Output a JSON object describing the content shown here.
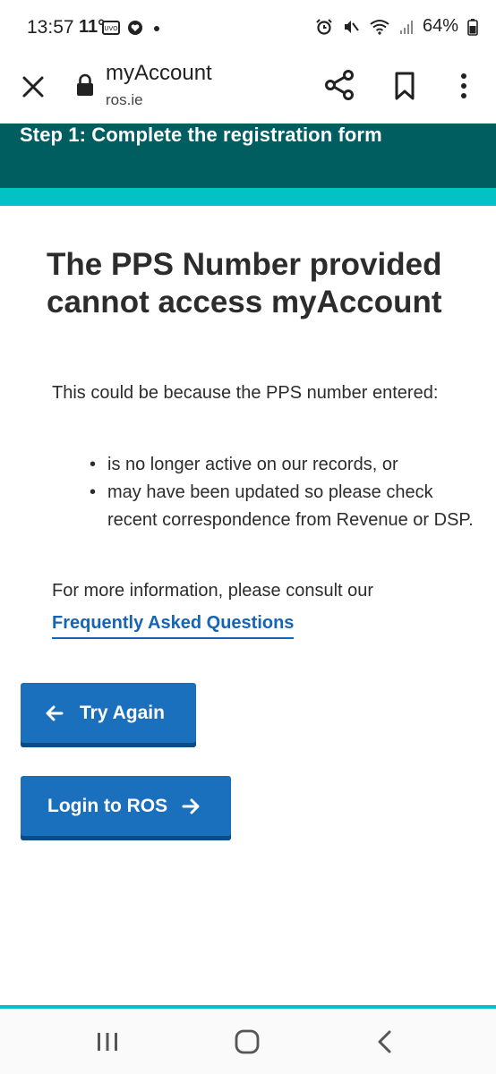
{
  "status_bar": {
    "time": "13:57",
    "temperature": "11°",
    "battery": "64%"
  },
  "browser": {
    "title": "myAccount",
    "domain": "ros.ie"
  },
  "banner": {
    "step_text": "Step 1: Complete the registration form",
    "color": "#005e60",
    "accent_color": "#03c1c5"
  },
  "content": {
    "heading": "The PPS Number provided cannot access myAccount",
    "intro": "This could be because the PPS number entered:",
    "reasons": [
      "is no longer active on our records, or",
      "may have been updated so please check recent correspondence from Revenue or DSP."
    ],
    "info": "For more information, please consult our",
    "faq_link": "Frequently Asked Questions"
  },
  "buttons": {
    "try_again": "Try Again",
    "login": "Login to ROS",
    "color": "#1a70bd"
  },
  "icons": {
    "close": "close-icon",
    "lock": "lock-icon",
    "share": "share-icon",
    "bookmark": "bookmark-icon",
    "more": "more-vert-icon",
    "arrow_left": "arrow-left-icon",
    "arrow_right": "arrow-right-icon"
  }
}
